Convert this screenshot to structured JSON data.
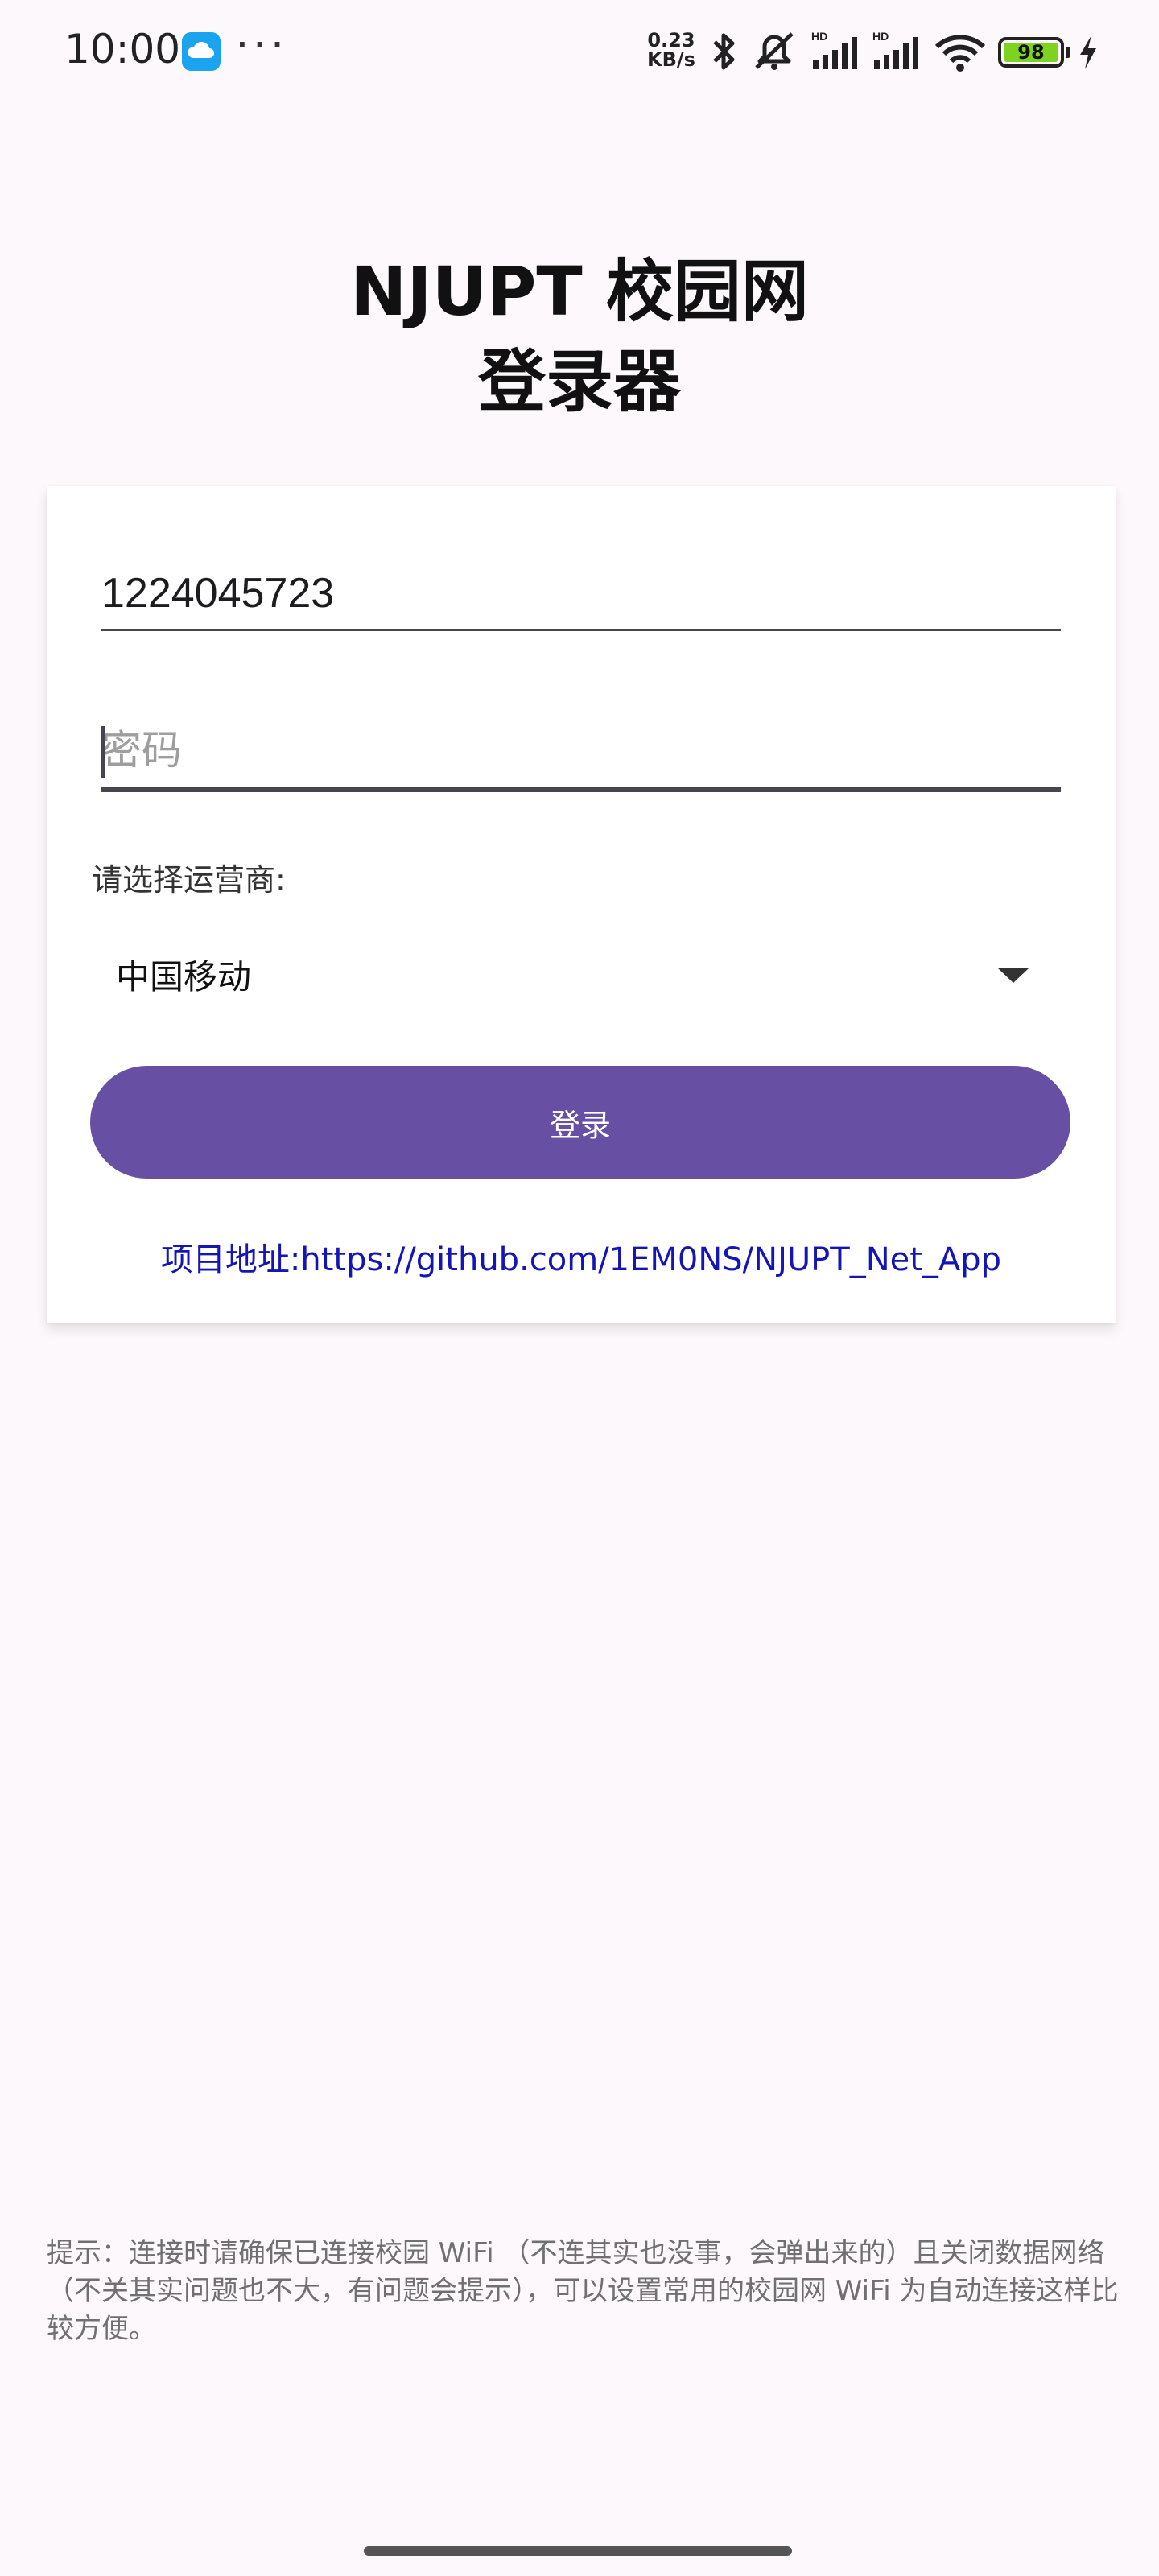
{
  "status_bar": {
    "time": "10:00",
    "notification_icon": "cloud-app-icon",
    "more": "···",
    "net_speed_value": "0.23",
    "net_speed_unit": "KB/s",
    "icons": [
      "bluetooth-icon",
      "mute-icon",
      "hd-signal-icon",
      "hd-signal-icon",
      "wifi-icon"
    ],
    "battery_level": "98",
    "charging_icon": "bolt-icon",
    "battery_color": "#7ed321"
  },
  "header": {
    "title_line1": "NJUPT 校园网",
    "title_line2": "登录器"
  },
  "form": {
    "account_value": "1224045723",
    "password_placeholder": "密码",
    "isp_label": "请选择运营商:",
    "isp_selected": "中国移动",
    "login_label": "登录",
    "project_link": "项目地址:https://github.com/1EM0NS/NJUPT_Net_App"
  },
  "footer": {
    "tip": "提示：连接时请确保已连接校园 WiFi （不连其实也没事，会弹出来的）且关闭数据网络（不关其实问题也不大，有问题会提示），可以设置常用的校园网 WiFi 为自动连接这样比较方便。"
  },
  "colors": {
    "primary": "#6750a4",
    "link": "#1515b5",
    "background": "#fcf8fc"
  }
}
